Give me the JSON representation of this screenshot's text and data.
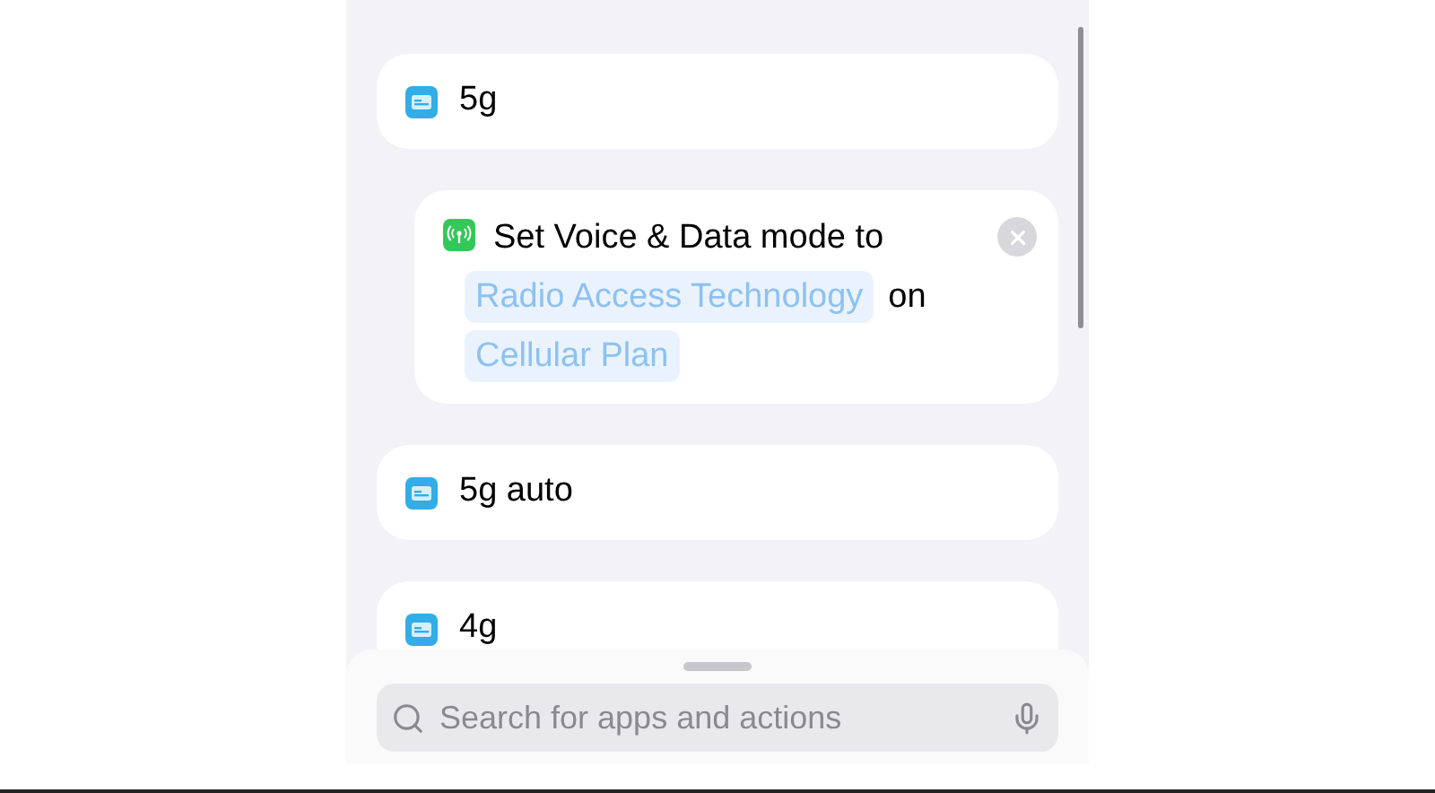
{
  "items": [
    {
      "kind": "variable",
      "label": "5g"
    },
    {
      "kind": "action",
      "parts": [
        {
          "kind": "text",
          "text": "Set Voice & Data mode to"
        },
        {
          "kind": "token",
          "text": "Radio Access Technology"
        },
        {
          "kind": "text",
          "text": "on"
        },
        {
          "kind": "token",
          "text": "Cellular Plan"
        }
      ]
    },
    {
      "kind": "variable",
      "label": "5g auto"
    },
    {
      "kind": "variable",
      "label": "4g"
    }
  ],
  "search": {
    "placeholder": "Search for apps and actions"
  }
}
